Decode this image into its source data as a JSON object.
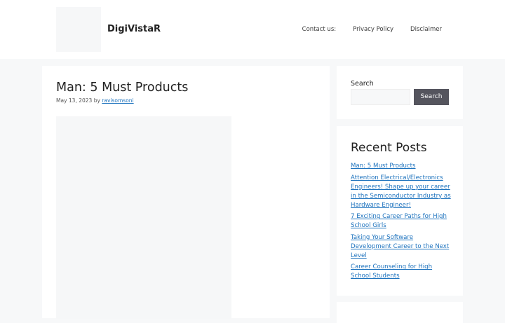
{
  "header": {
    "site_title": "DigiVistaR",
    "nav": [
      {
        "label": "Contact us:"
      },
      {
        "label": "Privacy Policy"
      },
      {
        "label": "Disclaimer"
      }
    ]
  },
  "article": {
    "title": "Man: 5 Must Products",
    "date": "May 13, 2023",
    "by": "by",
    "author": "ravisomsoni"
  },
  "sidebar": {
    "search": {
      "label": "Search",
      "input_value": "",
      "input_placeholder": "",
      "button_label": "Search"
    },
    "recent_posts": {
      "title": "Recent Posts",
      "items": [
        {
          "label": "Man: 5 Must Products"
        },
        {
          "label": "Attention Electrical/Electronics Engineers! Shape up your career in the Semiconductor Industry as Hardware Engineer!"
        },
        {
          "label": "7 Exciting Career Paths for High School Girls"
        },
        {
          "label": "Taking Your Software Development Career to the Next Level"
        },
        {
          "label": "Career Counseling for High School Students"
        }
      ]
    }
  },
  "colors": {
    "link": "#1e73be",
    "button_bg": "#55555e",
    "page_bg": "#f7f8f9"
  }
}
